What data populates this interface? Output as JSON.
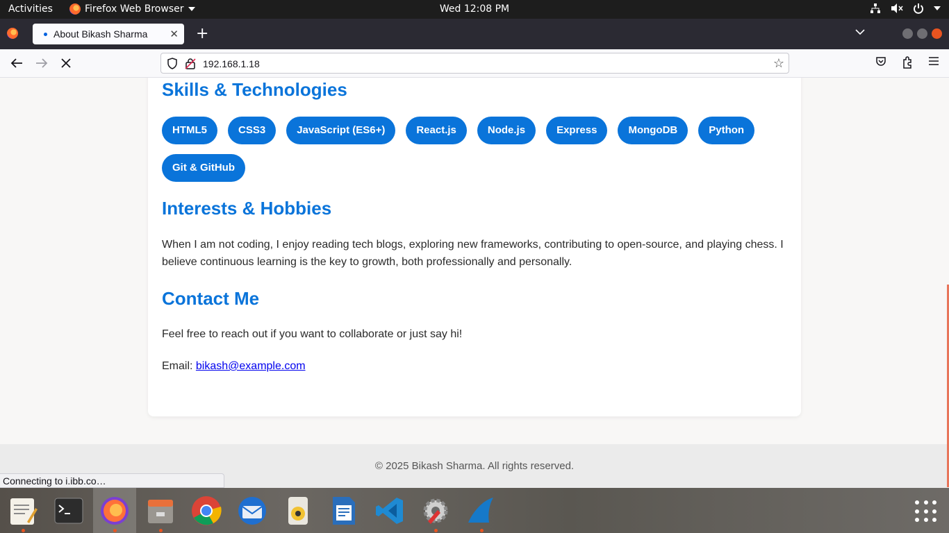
{
  "topbar": {
    "activities": "Activities",
    "app_name": "Firefox Web Browser",
    "clock": "Wed 12:08 PM"
  },
  "browser": {
    "tab_title": "About Bikash Sharma",
    "url": "192.168.1.18",
    "status_text": "Connecting to i.ibb.co…"
  },
  "page": {
    "skills_heading": "Skills & Technologies",
    "skills": [
      "HTML5",
      "CSS3",
      "JavaScript (ES6+)",
      "React.js",
      "Node.js",
      "Express",
      "MongoDB",
      "Python",
      "Git & GitHub"
    ],
    "interests_heading": "Interests & Hobbies",
    "interests_text": "When I am not coding, I enjoy reading tech blogs, exploring new frameworks, contributing to open-source, and playing chess. I believe continuous learning is the key to growth, both professionally and personally.",
    "contact_heading": "Contact Me",
    "contact_text": "Feel free to reach out if you want to collaborate or just say hi!",
    "email_label": "Email: ",
    "email": "bikash@example.com",
    "footer": "© 2025 Bikash Sharma. All rights reserved."
  },
  "dock": {
    "apps": [
      "text-editor-icon",
      "terminal-icon",
      "firefox-icon",
      "files-icon",
      "chrome-icon",
      "thunderbird-icon",
      "rhythmbox-icon",
      "libreoffice-writer-icon",
      "vscode-icon",
      "settings-icon",
      "wireshark-icon"
    ]
  },
  "colors": {
    "accent": "#0a74da",
    "ubuntu_orange": "#e95420"
  }
}
